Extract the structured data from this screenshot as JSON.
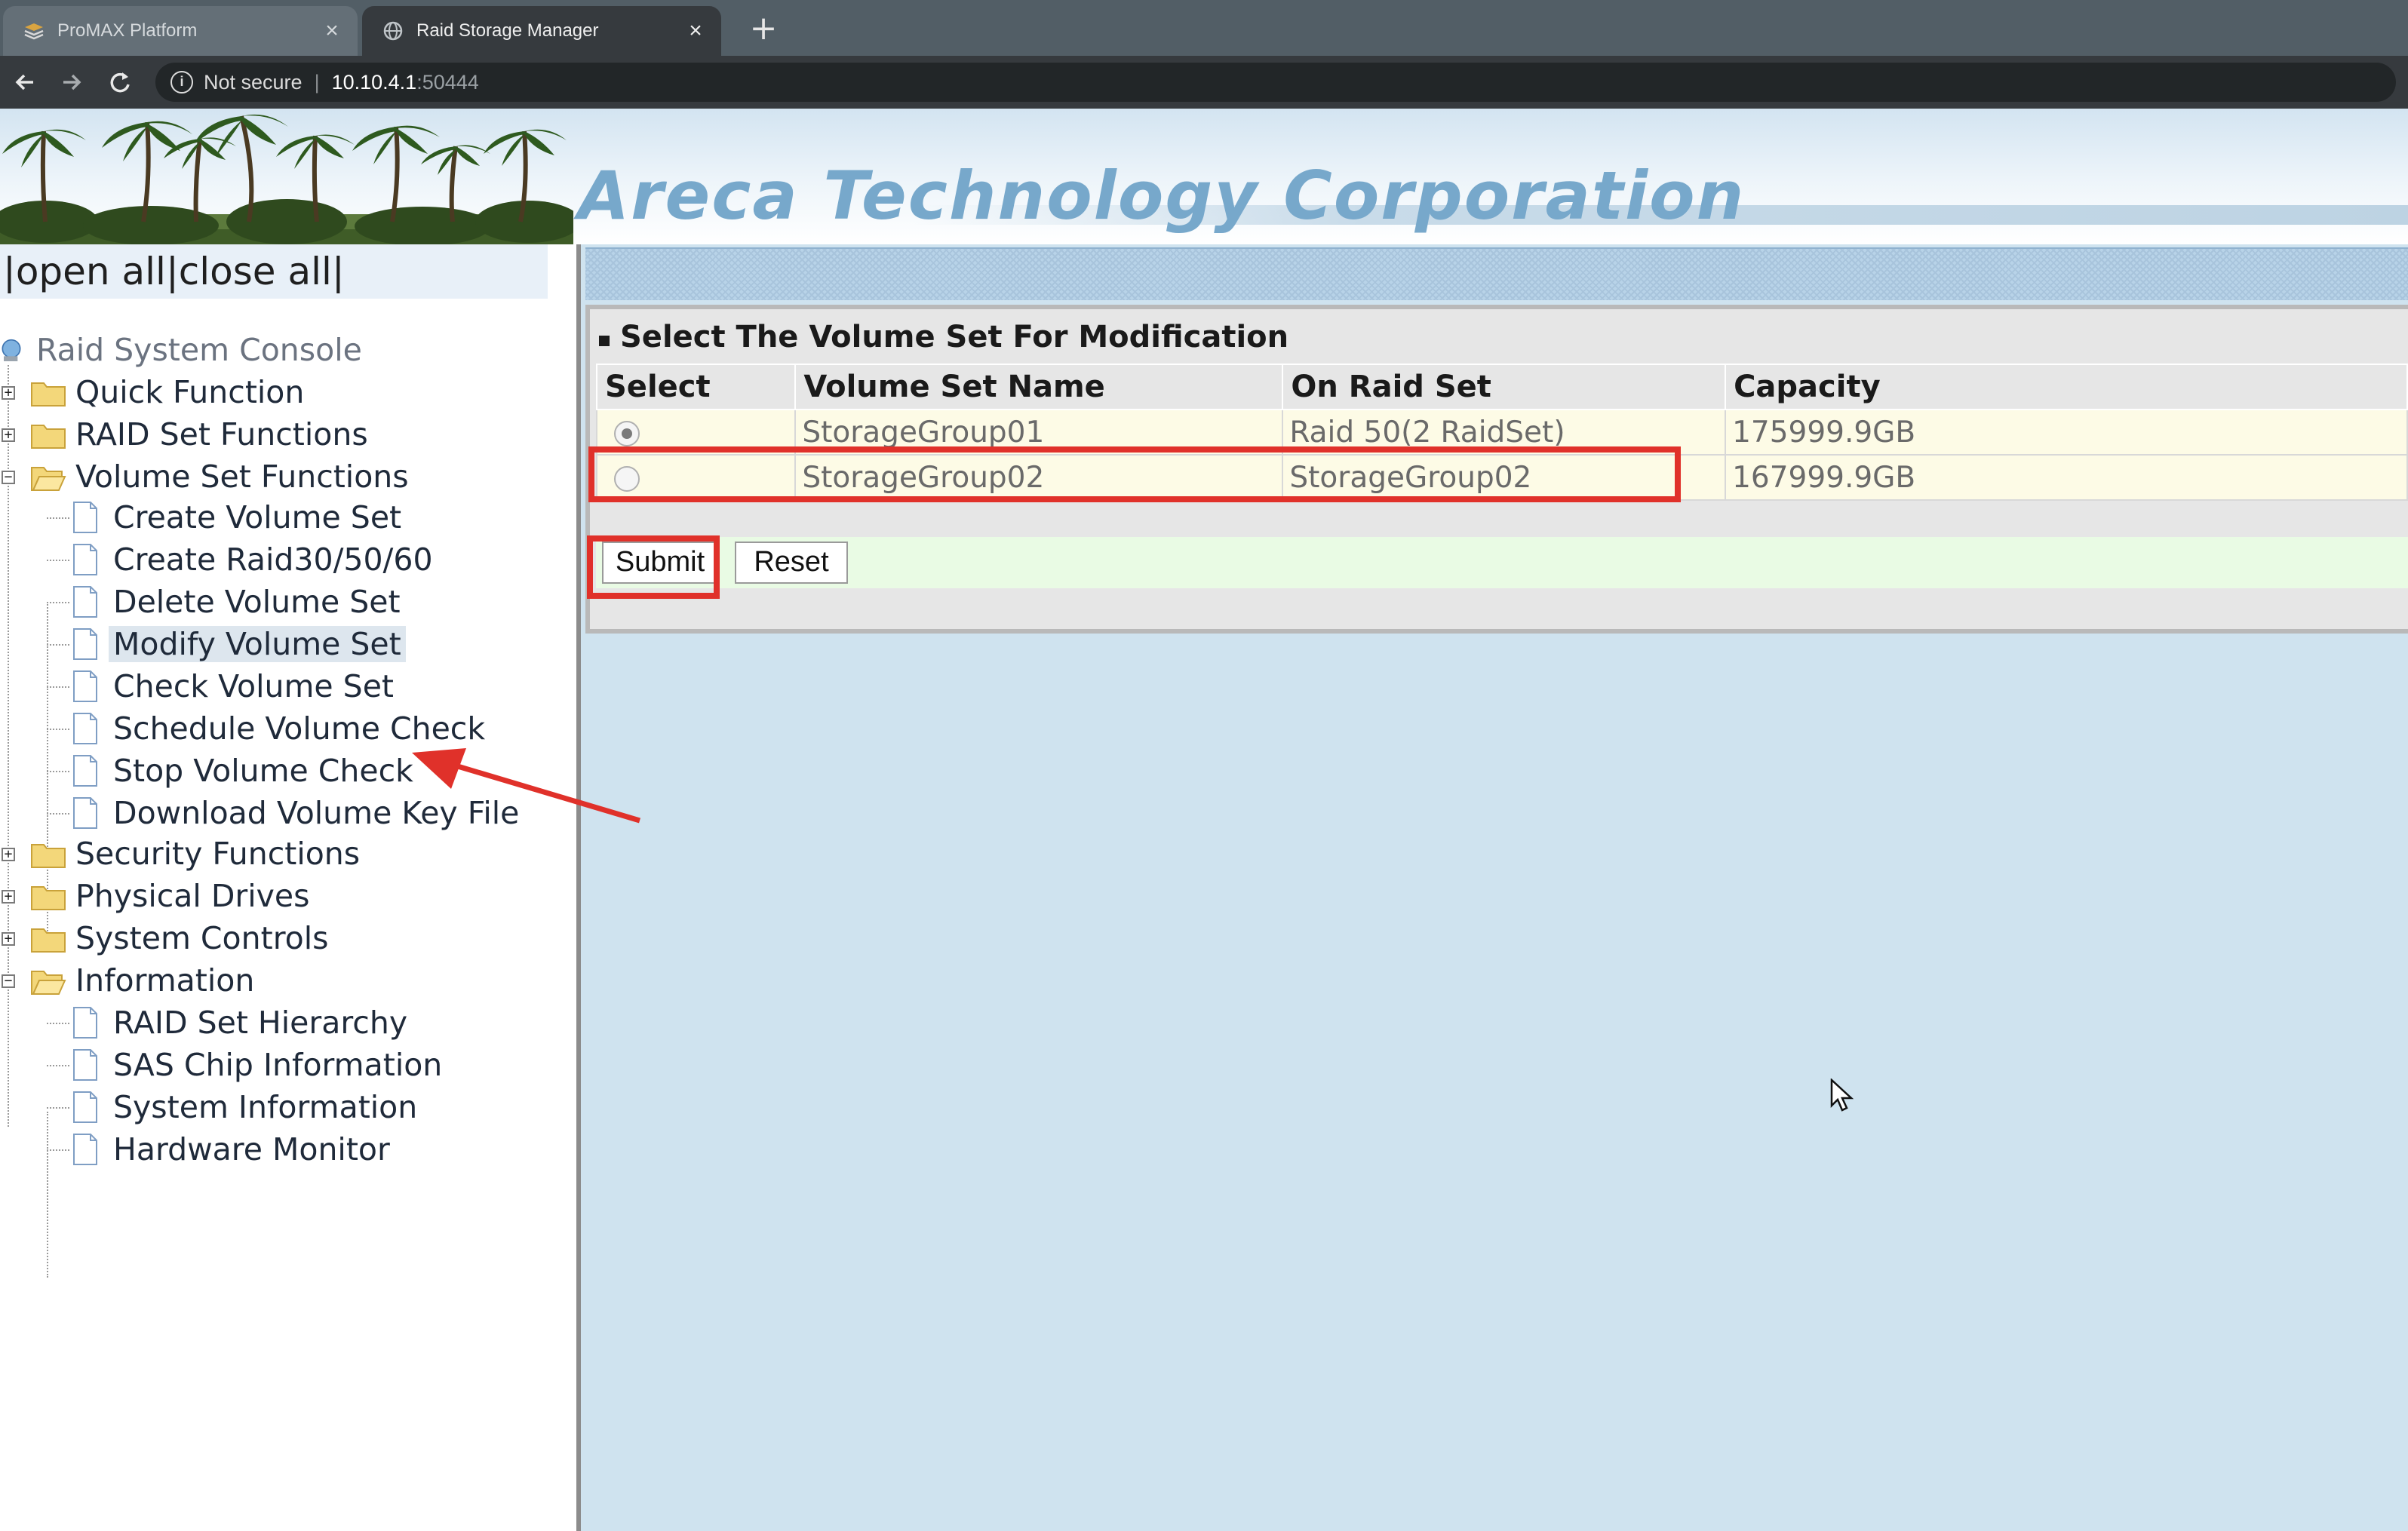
{
  "browser": {
    "tabs": [
      {
        "title": "ProMAX Platform",
        "icon": "stack-icon",
        "active": false
      },
      {
        "title": "Raid Storage Manager",
        "icon": "globe-icon",
        "active": true
      }
    ],
    "address": {
      "security": "Not secure",
      "host": "10.10.4.1",
      "port": ":50444"
    }
  },
  "banner": {
    "company": "Areca Technology Corporation"
  },
  "sidebar": {
    "expand_bar": "|open all|close all|",
    "root": "Raid System Console",
    "groups": [
      {
        "label": "Quick Function",
        "expanded": false,
        "items": []
      },
      {
        "label": "RAID Set Functions",
        "expanded": false,
        "items": []
      },
      {
        "label": "Volume Set Functions",
        "expanded": true,
        "items": [
          "Create Volume Set",
          "Create Raid30/50/60",
          "Delete Volume Set",
          "Modify Volume Set",
          "Check Volume Set",
          "Schedule Volume Check",
          "Stop Volume Check",
          "Download Volume Key File"
        ]
      },
      {
        "label": "Security Functions",
        "expanded": false,
        "items": []
      },
      {
        "label": "Physical Drives",
        "expanded": false,
        "items": []
      },
      {
        "label": "System Controls",
        "expanded": false,
        "items": []
      },
      {
        "label": "Information",
        "expanded": true,
        "items": [
          "RAID Set Hierarchy",
          "SAS Chip Information",
          "System Information",
          "Hardware Monitor"
        ]
      }
    ],
    "selected": "Modify Volume Set"
  },
  "panel": {
    "title": "Select The Volume Set For Modification",
    "columns": [
      "Select",
      "Volume Set Name",
      "On Raid Set",
      "Capacity"
    ],
    "rows": [
      {
        "selected": true,
        "name": "StorageGroup01",
        "raid_set": "Raid 50(2 RaidSet)",
        "capacity": "175999.9GB"
      },
      {
        "selected": false,
        "name": "StorageGroup02",
        "raid_set": "StorageGroup02",
        "capacity": "167999.9GB"
      }
    ],
    "buttons": {
      "submit": "Submit",
      "reset": "Reset"
    }
  },
  "colors": {
    "annotation": "#e0312a",
    "content_bg": "#cfe3ef",
    "banner_text": "#77a8cb"
  }
}
